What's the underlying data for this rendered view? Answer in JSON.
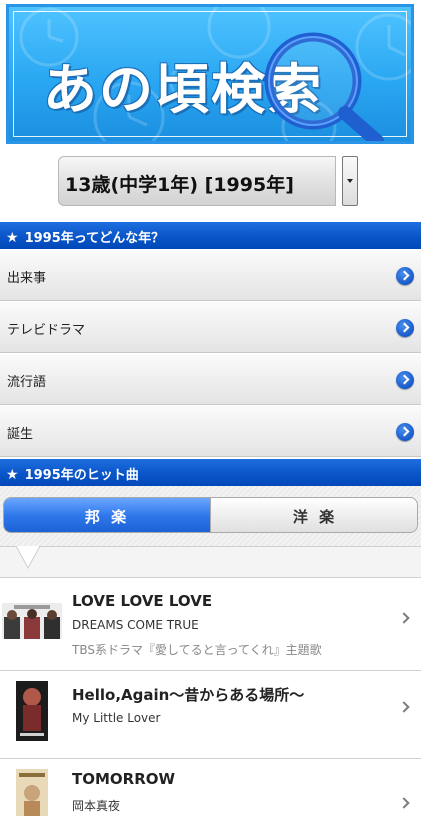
{
  "banner": {
    "title": "あの頃検索"
  },
  "age_select": {
    "selected": "13歳(中学1年) [1995年]"
  },
  "sections": {
    "year_header": "1995年ってどんな年？",
    "hits_header": "1995年のヒット曲"
  },
  "menu": {
    "items": [
      {
        "label": "出来事"
      },
      {
        "label": "テレビドラマ"
      },
      {
        "label": "流行語"
      },
      {
        "label": "誕生"
      }
    ]
  },
  "tabs": {
    "domestic": "邦 楽",
    "foreign": "洋 楽",
    "active": "domestic"
  },
  "songs": [
    {
      "title": "LOVE LOVE LOVE",
      "artist": "DREAMS COME TRUE",
      "note": "TBS系ドラマ『愛してると言ってくれ』主題歌"
    },
    {
      "title": "Hello,Again～昔からある場所～",
      "artist": "My Little Lover",
      "note": ""
    },
    {
      "title": "TOMORROW",
      "artist": "岡本真夜",
      "note": ""
    }
  ],
  "colors": {
    "header_blue": "#0a55c8",
    "banner_blue": "#2aa7f2",
    "go_button": "#1659c9"
  },
  "icons": {
    "section": "star-icon",
    "menu_go": "chevron-right-circle-icon",
    "song_go": "chevron-right-icon",
    "dropdown": "dropdown-arrow-icon"
  }
}
